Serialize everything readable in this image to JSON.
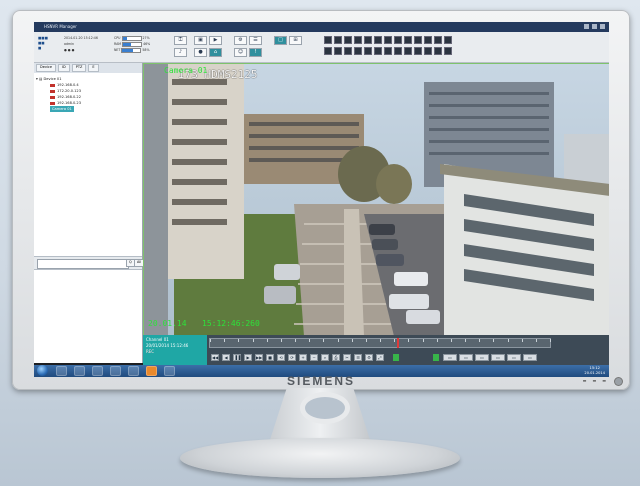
{
  "window": {
    "title": "HSNVR Manager"
  },
  "toolbar": {
    "datetime": "2014-01-20  15:12:46",
    "meters": [
      {
        "label": "CPU",
        "percent": 27
      },
      {
        "label": "RAM",
        "percent": 46
      },
      {
        "label": "NET",
        "percent": 58
      }
    ],
    "user_label": "admin"
  },
  "left_panel": {
    "tabs": [
      "Device",
      "ID",
      "PTZ",
      "E"
    ],
    "root": "Device 01",
    "cameras": [
      "192.168.0.4",
      "172.20.0.123",
      "192.168.0.22",
      "192.168.0.23"
    ],
    "selected_camera": "Camera 01",
    "search_placeholder": "",
    "buttons": [
      "Q",
      "All"
    ]
  },
  "video": {
    "osd_title": "I73 HDMS2125",
    "osd_overlay": "Camera 01",
    "osd_date": "20.01.14",
    "osd_time": "15:12:46:260"
  },
  "playback": {
    "channel": "Channel 01",
    "date": "20/01/2014",
    "time": "15:12:46",
    "status": "REC",
    "progress": 0.55
  },
  "taskbar": {
    "time": "15:12",
    "date": "20.01.2014"
  },
  "monitor": {
    "brand": "SIEMENS"
  },
  "colors": {
    "accent": "#1fa7a5",
    "title_bar": "#243a5e",
    "osd_green": "#2de23a"
  }
}
